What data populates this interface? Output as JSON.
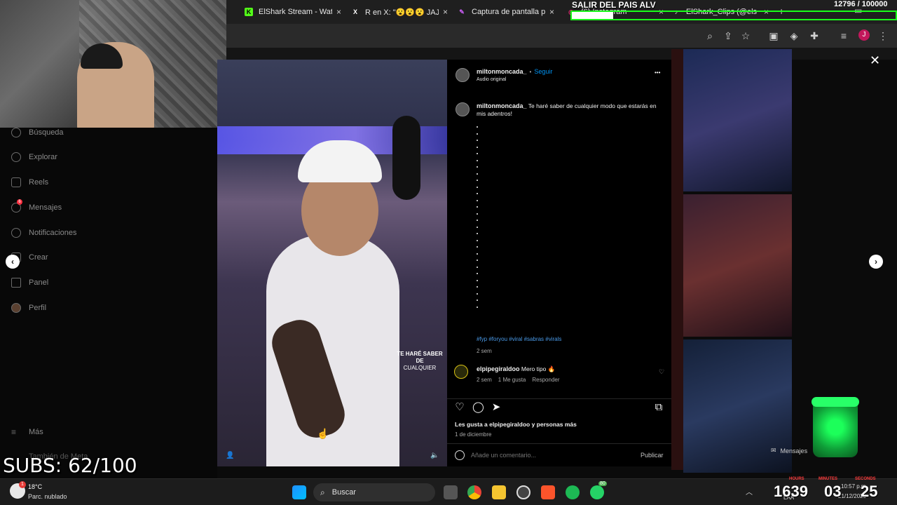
{
  "browser": {
    "tabs": [
      {
        "favicon": "K",
        "favicon_color": "#53fc18",
        "title": "ElShark Stream - Watc",
        "close": "×"
      },
      {
        "favicon": "X",
        "favicon_color": "#ffffff",
        "title": "R en X: \"😮😮😮 JAJA",
        "close": "×"
      },
      {
        "favicon": "✎",
        "favicon_color": "#c65cf0",
        "title": "Captura de pantalla p",
        "close": "×"
      },
      {
        "favicon": "◎",
        "favicon_color": "#e1306c",
        "title": "(6) Instagram",
        "close": "×"
      },
      {
        "favicon": "♪",
        "favicon_color": "#e0e0e0",
        "title": "ElShark_Clips (@els",
        "close": "×"
      }
    ],
    "new_tab": "+",
    "minimize": "▭",
    "profile_initial": "J",
    "toolbar_icons": [
      "zoom-icon",
      "share-icon",
      "star-icon",
      "cast-icon",
      "extension-icon",
      "puzzle-icon",
      "menu-list-icon",
      "profile-icon",
      "more-icon"
    ]
  },
  "stream_overlay": {
    "goal_title": "SALIR DEL PAIS ALV",
    "goal_count": "12796 / 100000",
    "goal_progress": 0.128,
    "subs": "SUBS: 62/100"
  },
  "sidebar": {
    "items": [
      {
        "label": "Búsqueda",
        "icon": "search-icon"
      },
      {
        "label": "Explorar",
        "icon": "compass-icon"
      },
      {
        "label": "Reels",
        "icon": "reels-icon"
      },
      {
        "label": "Mensajes",
        "icon": "messenger-icon",
        "badge": "6"
      },
      {
        "label": "Notificaciones",
        "icon": "heart-icon"
      },
      {
        "label": "Crear",
        "icon": "plus-icon"
      },
      {
        "label": "Panel",
        "icon": "dashboard-icon"
      },
      {
        "label": "Perfil",
        "icon": "profile-icon"
      }
    ],
    "more": "Más",
    "also_meta": "También de Meta"
  },
  "reel": {
    "caption_line1": "TE HARÉ SABER DE",
    "caption_line2": "CUALQUIER"
  },
  "post": {
    "username": "miltonmoncada_",
    "follow": "Seguir",
    "separator": "•",
    "audio": "Audio original",
    "more": "•••",
    "caption_user": "miltonmoncada_",
    "caption_text": "Te haré saber de cualquier modo que estarás en mis adentros!",
    "dots": [
      ".",
      ".",
      ".",
      ".",
      ".",
      ".",
      ".",
      ".",
      ".",
      ".",
      ".",
      ".",
      ".",
      ".",
      ".",
      ".",
      ".",
      ".",
      ".",
      ".",
      ".",
      ".",
      ".",
      ".",
      ".",
      ".",
      ".",
      "."
    ],
    "hashtags": "#fyp #foryou #viral #sabras #virals",
    "caption_time": "2 sem",
    "comment": {
      "user": "elpipegiraldoo",
      "text": "Mero tipo 🔥",
      "time": "2 sem",
      "likes": "1 Me gusta",
      "reply": "Responder"
    },
    "likes_text": "Les gusta a elpipegiraldoo y personas más",
    "date": "1 de diciembre",
    "add_comment_placeholder": "Añade un comentario...",
    "publish": "Publicar"
  },
  "mensajes_float": "Mensajes",
  "taskbar": {
    "weather_temp": "18°C",
    "weather_desc": "Parc. nublado",
    "weather_badge": "1",
    "search_label": "Buscar",
    "whatsapp_badge": "80",
    "time": "10:57 p.m.",
    "date": "21/12/2025",
    "lang": "LAA"
  },
  "timer": {
    "hours_label": "HOURS",
    "minutes_label": "MINUTES",
    "seconds_label": "SECONDS",
    "hours": "1639",
    "minutes": "03",
    "seconds": "25"
  },
  "colors": {
    "ig_blue": "#0095f6",
    "goal_green": "#1aff1a",
    "timer_red": "#ff3b3b"
  }
}
